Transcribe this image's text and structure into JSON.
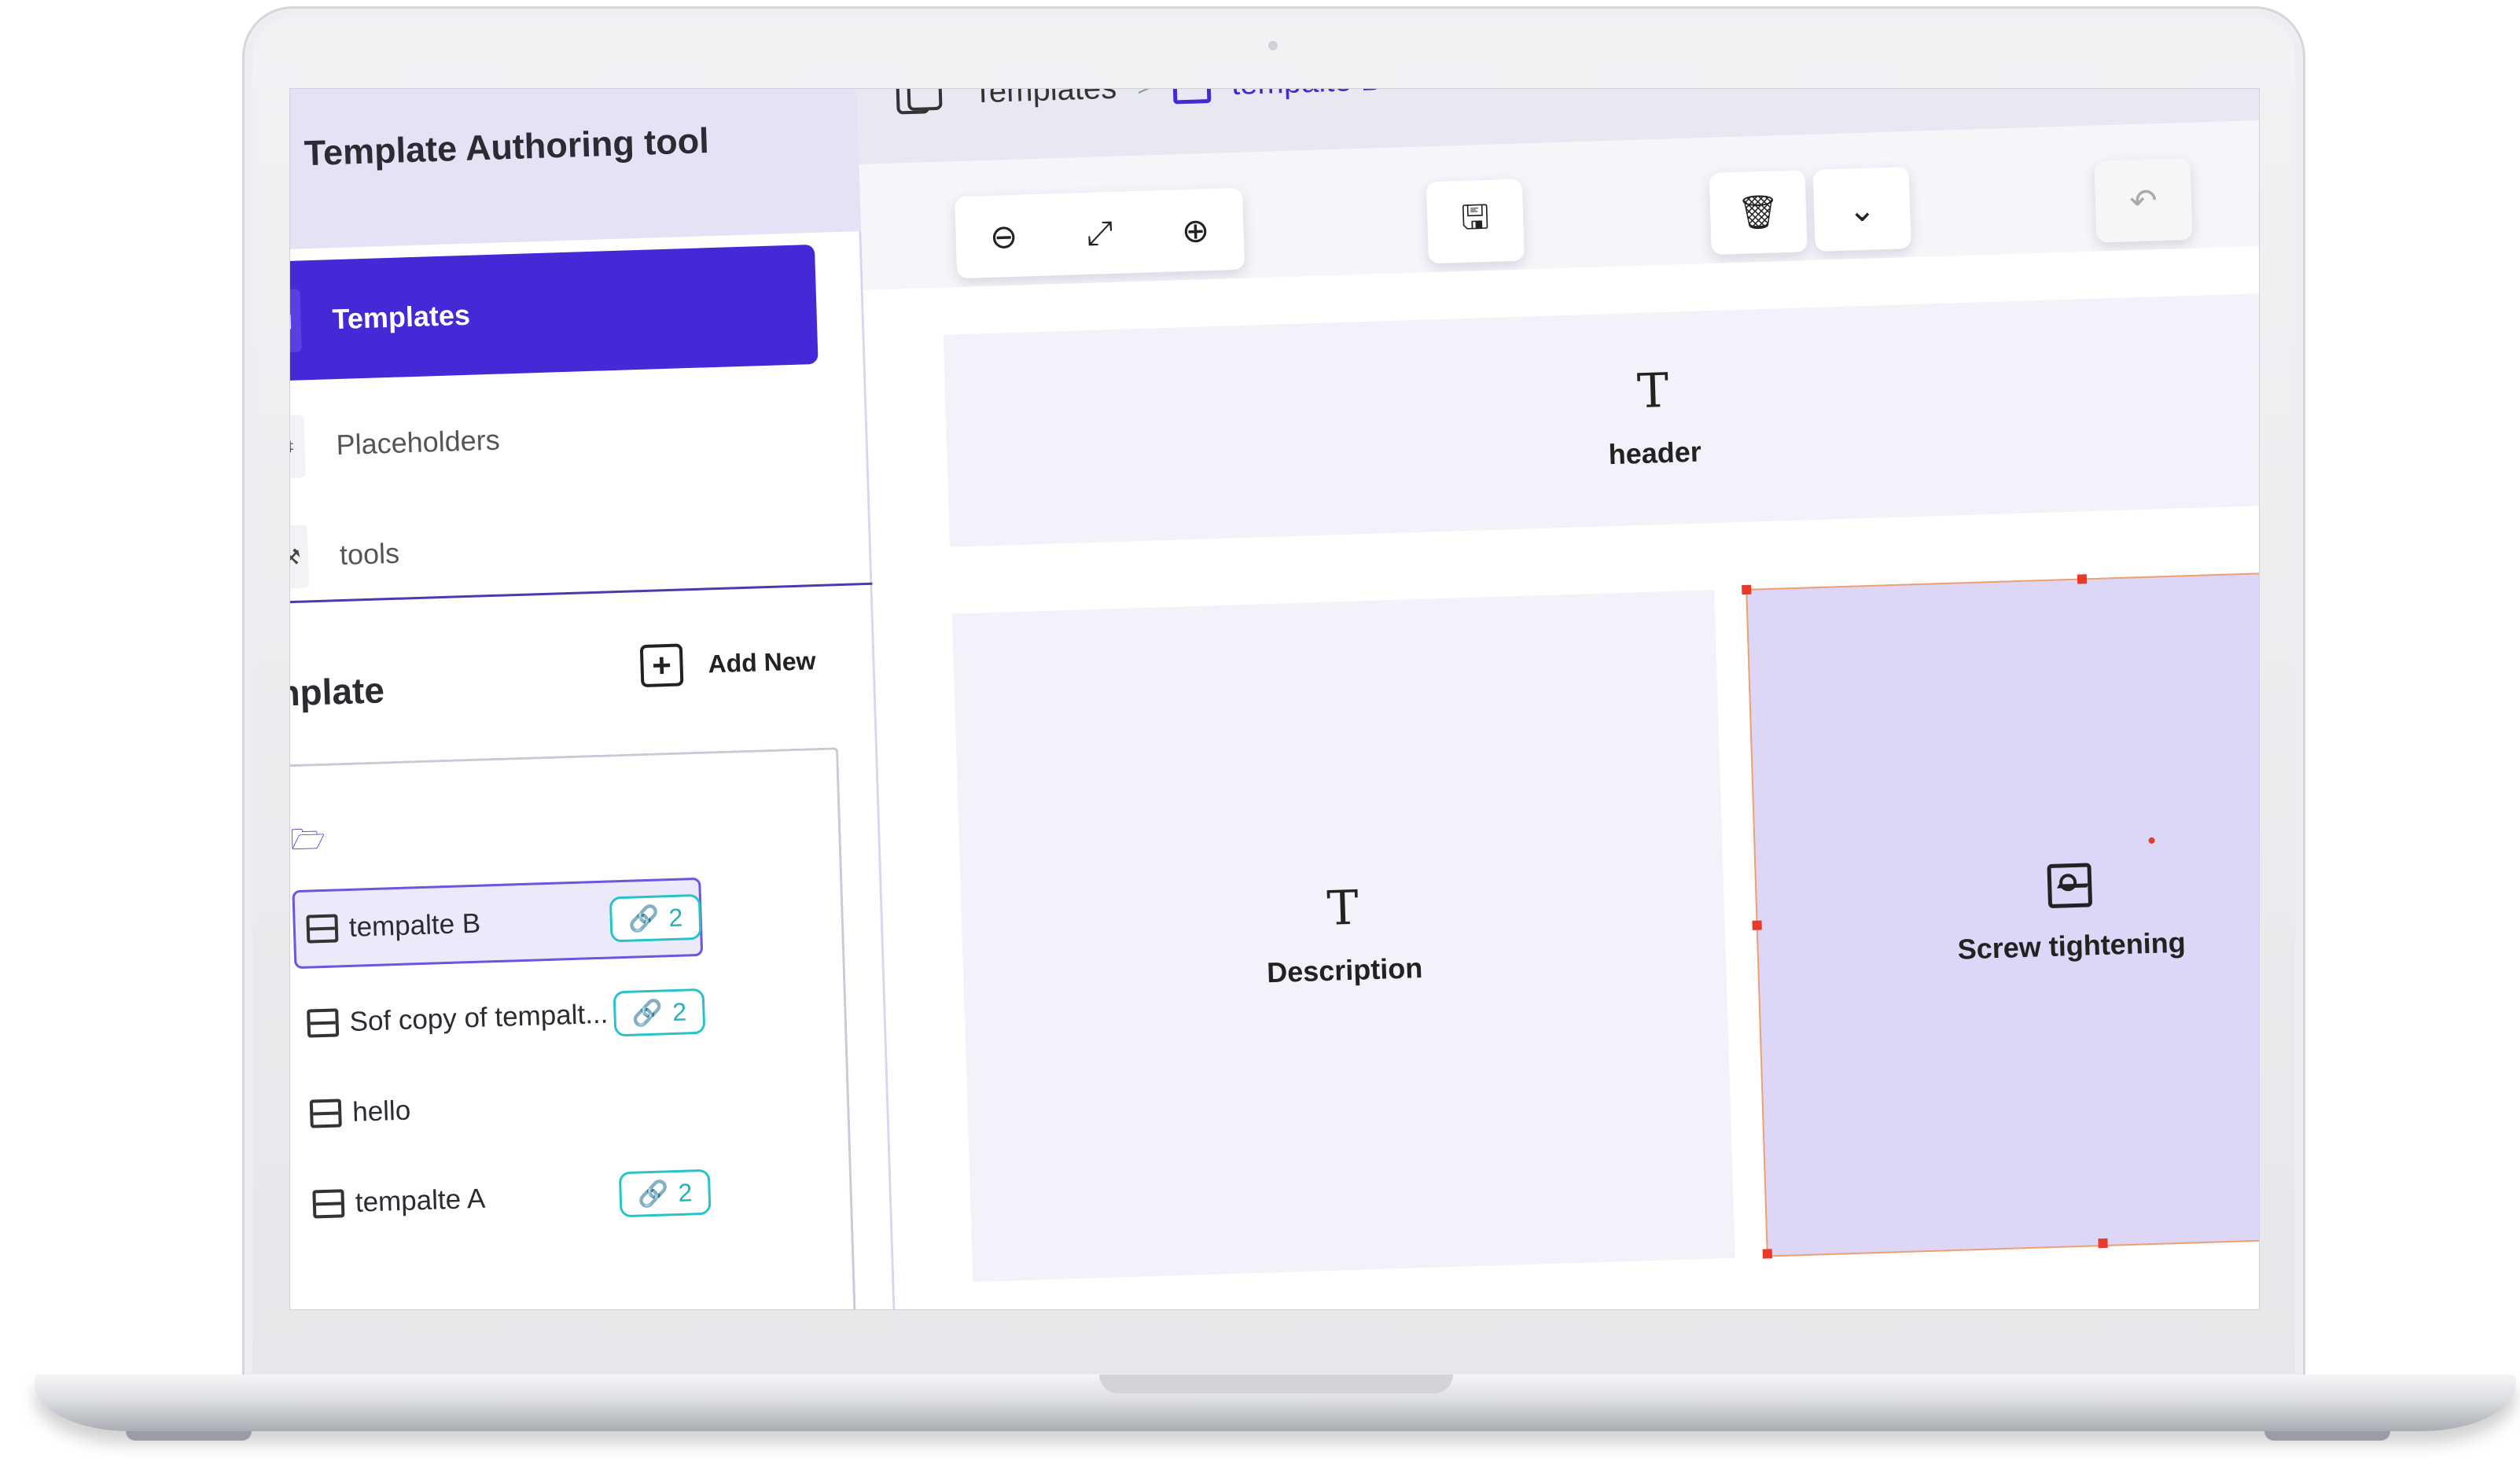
{
  "app": {
    "title": "Template Authoring tool"
  },
  "sidebar": {
    "nav": [
      {
        "label": "Templates",
        "icon": "layout-icon",
        "active": true
      },
      {
        "label": "Placeholders",
        "icon": "placeholder-icon",
        "active": false
      },
      {
        "label": "tools",
        "icon": "tools-icon",
        "active": false
      }
    ],
    "section": {
      "title": "nplate",
      "add_new_label": "Add New"
    },
    "tree": [
      {
        "label": "tempalte B",
        "links": "2",
        "selected": true
      },
      {
        "label": "Sof copy of tempalt...",
        "links": "2",
        "selected": false
      },
      {
        "label": "hello",
        "links": null,
        "selected": false
      },
      {
        "label": "tempalte A",
        "links": "2",
        "selected": false
      }
    ]
  },
  "breadcrumb": {
    "root": "Templates",
    "separator": ">",
    "current": "tempalte B"
  },
  "toolbar": {
    "zoom_out_icon": "zoom-out-icon",
    "fit_icon": "expand-icon",
    "zoom_in_icon": "zoom-in-icon",
    "save_icon": "save-icon",
    "delete_icon": "trash-icon",
    "more_icon": "chevron-down-icon",
    "undo_icon": "undo-icon"
  },
  "canvas": {
    "blocks": [
      {
        "type": "text",
        "label": "header"
      },
      {
        "type": "text",
        "label": "Description"
      },
      {
        "type": "image",
        "label": "Screw tightening",
        "selected": true
      }
    ]
  },
  "colors": {
    "accent": "#4429d6",
    "badge": "#27c3c9",
    "block_bg": "#f3f2fb",
    "selected_block_bg": "#dcd6f7",
    "handle": "#e8392a"
  }
}
